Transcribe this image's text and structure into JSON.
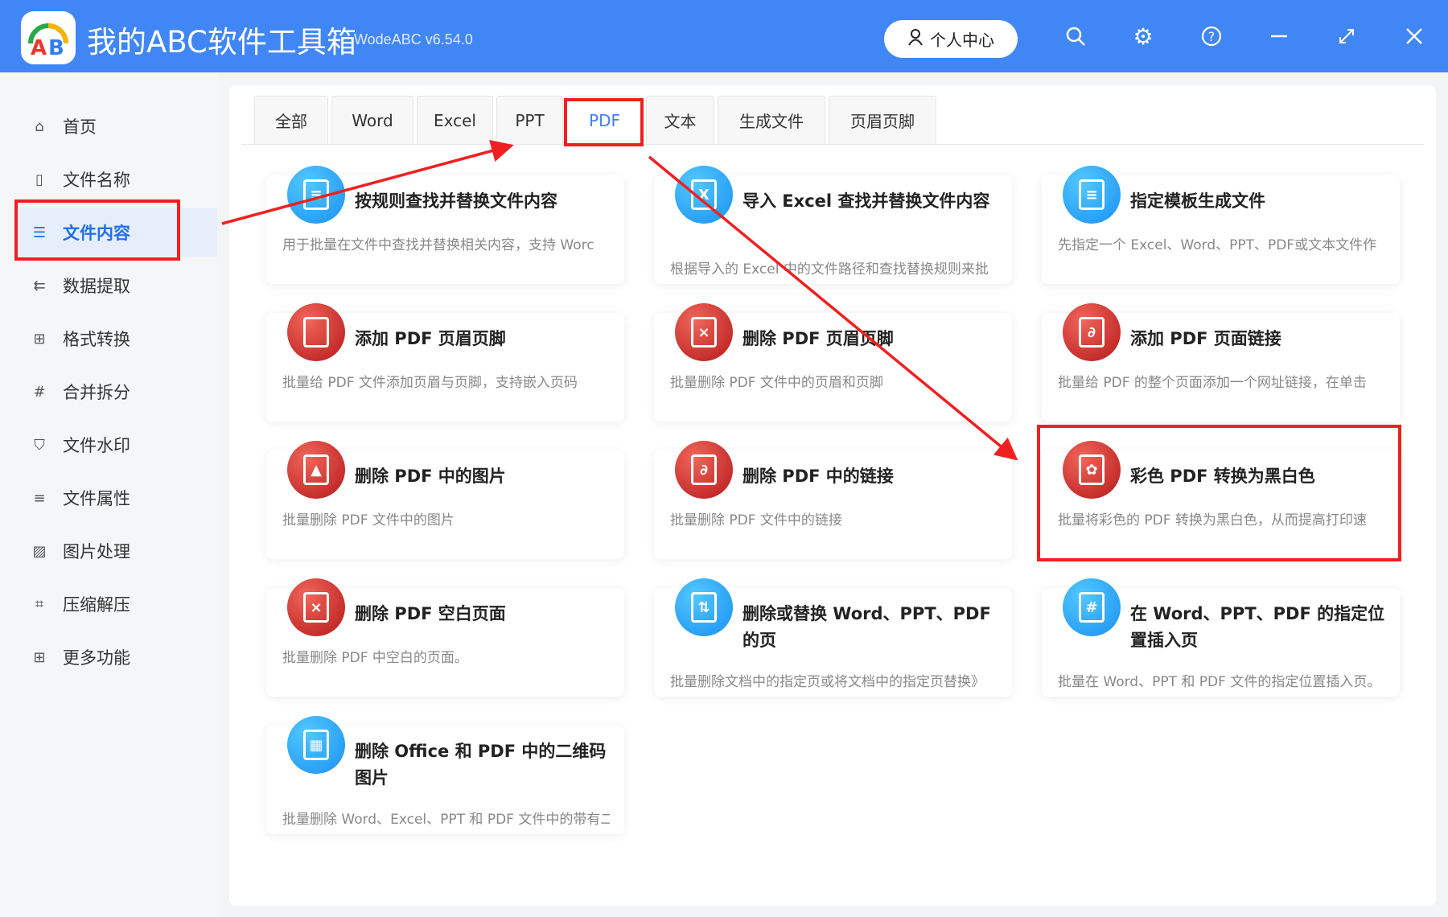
{
  "header": {
    "title": "我的ABC软件工具箱",
    "version": "WodeABC v6.54.0",
    "user_center": "个人中心"
  },
  "sidebar": {
    "items": [
      {
        "label": "首页",
        "icon": "⌂"
      },
      {
        "label": "文件名称",
        "icon": "▯"
      },
      {
        "label": "文件内容",
        "icon": "☰",
        "active": true
      },
      {
        "label": "数据提取",
        "icon": "⇇"
      },
      {
        "label": "格式转换",
        "icon": "⊞"
      },
      {
        "label": "合并拆分",
        "icon": "#"
      },
      {
        "label": "文件水印",
        "icon": "⛉"
      },
      {
        "label": "文件属性",
        "icon": "≡"
      },
      {
        "label": "图片处理",
        "icon": "▨"
      },
      {
        "label": "压缩解压",
        "icon": "⌗"
      },
      {
        "label": "更多功能",
        "icon": "⊞"
      }
    ]
  },
  "tabs": [
    {
      "label": "全部"
    },
    {
      "label": "Word"
    },
    {
      "label": "Excel"
    },
    {
      "label": "PPT"
    },
    {
      "label": "PDF",
      "active": true
    },
    {
      "label": "文本"
    },
    {
      "label": "生成文件"
    },
    {
      "label": "页眉页脚"
    }
  ],
  "cards": [
    {
      "title": "按规则查找并替换文件内容",
      "desc": "用于批量在文件中查找并替换相关内容，支持 Worc",
      "color": "blue",
      "glyph": "≡"
    },
    {
      "title": "导入 Excel 查找并替换文件内容",
      "desc": "根据导入的 Excel 中的文件路径和查找替换规则来批",
      "color": "blue",
      "glyph": "X"
    },
    {
      "title": "指定模板生成文件",
      "desc": "先指定一个 Excel、Word、PPT、PDF或文本文件作",
      "color": "blue",
      "glyph": "≡"
    },
    {
      "title": "添加 PDF 页眉页脚",
      "desc": "批量给 PDF 文件添加页眉与页脚，支持嵌入页码",
      "color": "red",
      "glyph": ""
    },
    {
      "title": "删除 PDF 页眉页脚",
      "desc": "批量删除 PDF 文件中的页眉和页脚",
      "color": "red",
      "glyph": "×"
    },
    {
      "title": "添加 PDF 页面链接",
      "desc": "批量给 PDF 的整个页面添加一个网址链接，在单击",
      "color": "red",
      "glyph": "∂"
    },
    {
      "title": "删除 PDF 中的图片",
      "desc": "批量删除 PDF 文件中的图片",
      "color": "red",
      "glyph": "▲"
    },
    {
      "title": "删除 PDF 中的链接",
      "desc": "批量删除 PDF 文件中的链接",
      "color": "red",
      "glyph": "∂"
    },
    {
      "title": "彩色 PDF 转换为黑白色",
      "desc": "批量将彩色的 PDF 转换为黑白色，从而提高打印速",
      "color": "red",
      "glyph": "✿"
    },
    {
      "title": "删除 PDF 空白页面",
      "desc": "批量删除 PDF 中空白的页面。",
      "color": "red",
      "glyph": "×"
    },
    {
      "title": "删除或替换 Word、PPT、PDF 的页",
      "desc": "批量删除文档中的指定页或将文档中的指定页替换》",
      "color": "blue",
      "glyph": "⇅"
    },
    {
      "title": "在 Word、PPT、PDF 的指定位置插入页",
      "desc": "批量在 Word、PPT 和 PDF 文件的指定位置插入页。",
      "color": "blue",
      "glyph": "#"
    },
    {
      "title": "删除 Office 和 PDF 中的二维码图片",
      "desc": "批量删除 Word、Excel、PPT 和 PDF 文件中的带有二",
      "color": "blue",
      "glyph": "▦"
    }
  ],
  "colors": {
    "header": "#4186f5",
    "accent": "#3f80f0",
    "annotation": "#f02020"
  }
}
